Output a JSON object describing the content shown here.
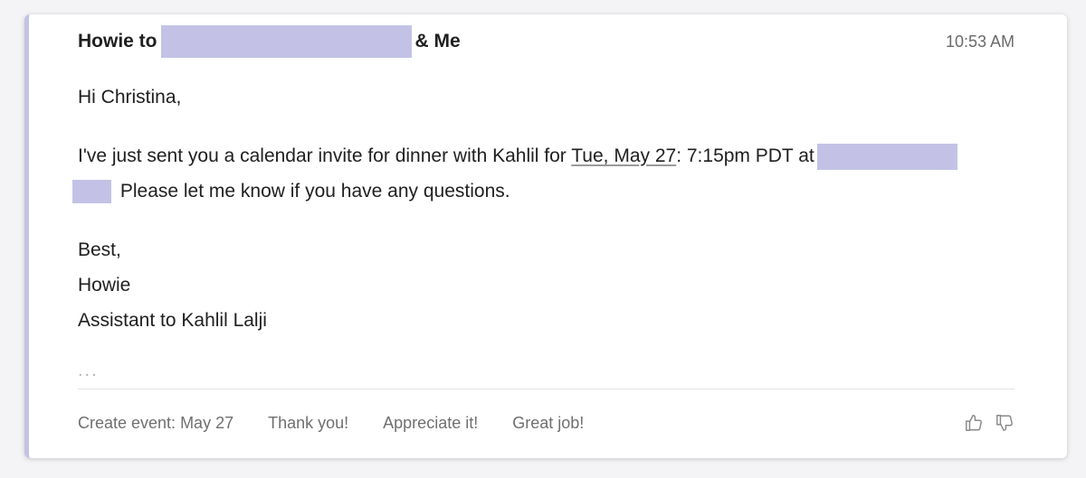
{
  "header": {
    "sender": "Howie to",
    "recipients_suffix": "& Me",
    "time": "10:53 AM"
  },
  "body": {
    "greeting": "Hi Christina,",
    "line1_pre": "I've just sent you a calendar invite for dinner with Kahlil for ",
    "date_link": "Tue, May 27",
    "line1_post": ": 7:15pm PDT at",
    "line2": "Please let me know if you have any questions.",
    "signoff": "Best,",
    "name": "Howie",
    "title": "Assistant to Kahlil Lalji",
    "ellipsis": "..."
  },
  "actions": {
    "create_event": "Create event: May 27",
    "reply1": "Thank you!",
    "reply2": "Appreciate it!",
    "reply3": "Great job!"
  },
  "colors": {
    "accent": "#c3c2e6",
    "text": "#1f1f1f",
    "muted": "#6f6f6f"
  }
}
